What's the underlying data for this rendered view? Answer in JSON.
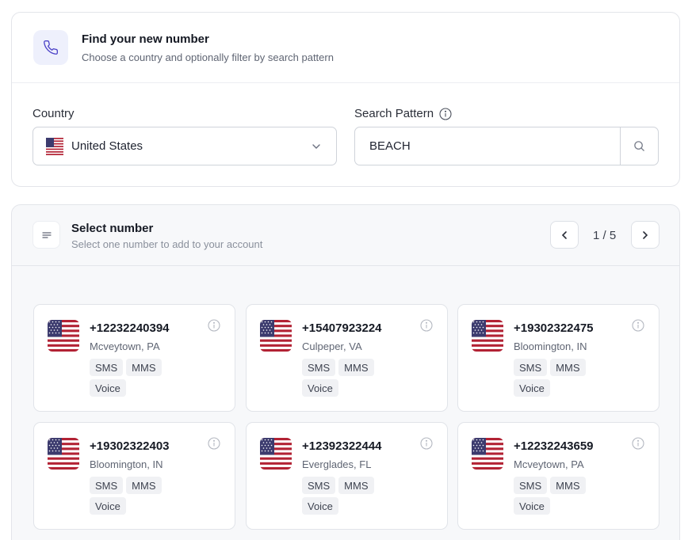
{
  "finder": {
    "title": "Find your new number",
    "subtitle": "Choose a country and optionally filter by search pattern",
    "country_label": "Country",
    "country_value": "United States",
    "pattern_label": "Search Pattern",
    "pattern_value": "BEACH"
  },
  "select": {
    "title": "Select number",
    "subtitle": "Select one number to add to your account",
    "pagination": "1 / 5"
  },
  "numbers": [
    {
      "phone": "+12232240394",
      "location": "Mcveytown, PA",
      "tags": [
        "SMS",
        "MMS",
        "Voice"
      ]
    },
    {
      "phone": "+15407923224",
      "location": "Culpeper, VA",
      "tags": [
        "SMS",
        "MMS",
        "Voice"
      ]
    },
    {
      "phone": "+19302322475",
      "location": "Bloomington, IN",
      "tags": [
        "SMS",
        "MMS",
        "Voice"
      ]
    },
    {
      "phone": "+19302322403",
      "location": "Bloomington, IN",
      "tags": [
        "SMS",
        "MMS",
        "Voice"
      ]
    },
    {
      "phone": "+12392322444",
      "location": "Everglades, FL",
      "tags": [
        "SMS",
        "MMS",
        "Voice"
      ]
    },
    {
      "phone": "+12232243659",
      "location": "Mcveytown, PA",
      "tags": [
        "SMS",
        "MMS",
        "Voice"
      ]
    }
  ],
  "icons": {
    "phone": "phone-icon",
    "flag": "us-flag-icon",
    "chevron": "chevron-down-icon",
    "search": "search-icon",
    "info": "info-icon",
    "list": "list-icon",
    "prev": "chevron-left-icon",
    "next": "chevron-right-icon"
  },
  "colors": {
    "accent": "#4f46c8",
    "accent_bg": "#eef0fc",
    "flag_red": "#b22234",
    "flag_blue": "#3c3b6e"
  }
}
